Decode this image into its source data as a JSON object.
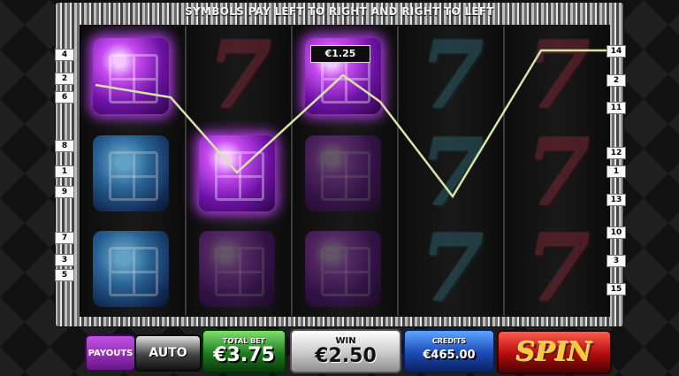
{
  "header": {
    "notice": "SYMBOLS PAY LEFT TO RIGHT AND RIGHT TO LEFT"
  },
  "win_tag": {
    "amount": "€1.25"
  },
  "reels": [
    [
      "purple-gem",
      "blue-gem",
      "blue-gem"
    ],
    [
      "red-seven",
      "purple-gem",
      "purple-gem-dim"
    ],
    [
      "purple-gem",
      "purple-gem-dim",
      "purple-gem-dim"
    ],
    [
      "teal-seven",
      "teal-seven",
      "teal-seven"
    ],
    [
      "red-seven",
      "red-seven",
      "red-seven"
    ]
  ],
  "left_line_numbers": [
    "4",
    "2",
    "6",
    "8",
    "1",
    "9",
    "7",
    "3",
    "5"
  ],
  "right_line_numbers": [
    "14",
    "2",
    "11",
    "12",
    "1",
    "13",
    "10",
    "3",
    "15"
  ],
  "controls": {
    "payouts_label": "PAYOUTS",
    "auto_label": "AUTO",
    "total_bet_label": "TOTAL BET",
    "total_bet_value": "€3.75",
    "win_label": "WIN",
    "win_value": "€2.50",
    "credits_label": "CREDITS",
    "credits_value": "€465.00",
    "spin_label": "SPIN"
  },
  "colors": {
    "payline": "#d7e3a8",
    "purple_gem": "#b33ee8",
    "spin_button": "#c81414"
  }
}
